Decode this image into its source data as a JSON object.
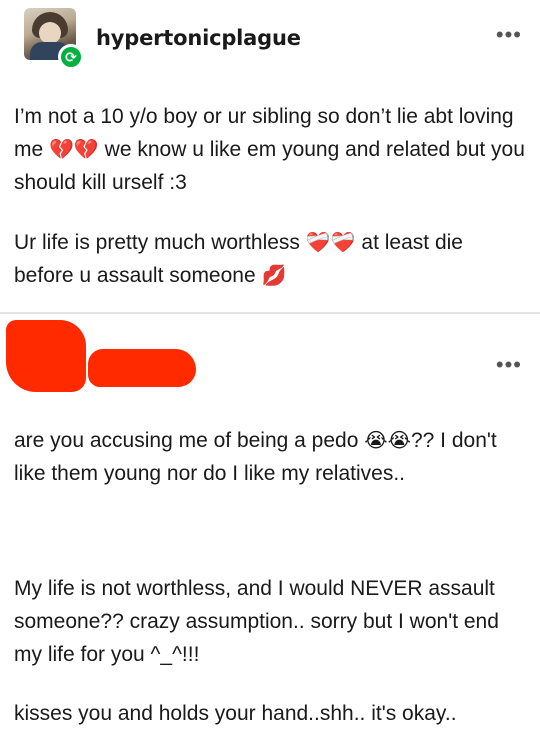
{
  "post": {
    "username": "hypertonicplague",
    "more_glyph": "•••",
    "paragraphs": [
      {
        "text_a": "I’m not a 10 y/o boy or ur sibling so don’t lie abt loving me ",
        "emoji": "💔💔",
        "text_b": " we know u like em young and related but you should kill urself :3"
      },
      {
        "text_a": "Ur life is pretty much worthless ",
        "emoji": "❤️‍🩹❤️‍🩹",
        "text_b": " at least die before u assault someone ",
        "emoji2": "💋"
      }
    ]
  },
  "reply": {
    "username": "[redacted]",
    "more_glyph": "•••",
    "paragraphs": [
      {
        "text_a": "are you accusing me of being a pedo ",
        "emoji": "😭😭",
        "text_b": "?? I don't like them young nor do I like my relatives.."
      },
      {
        "text": "My life is not worthless, and I would NEVER assault someone?? crazy assumption.. sorry but I won't end my life for you ^_^!!!"
      },
      {
        "text": "kisses you and holds your hand..shh.. it's okay.."
      }
    ]
  },
  "icons": {
    "avatar": "user-avatar",
    "reblog": "reblog-icon",
    "more": "more-horizontal-icon"
  },
  "colors": {
    "reblog_badge": "#00b140",
    "redaction": "#ff2a00",
    "text": "#1a1a1a"
  }
}
